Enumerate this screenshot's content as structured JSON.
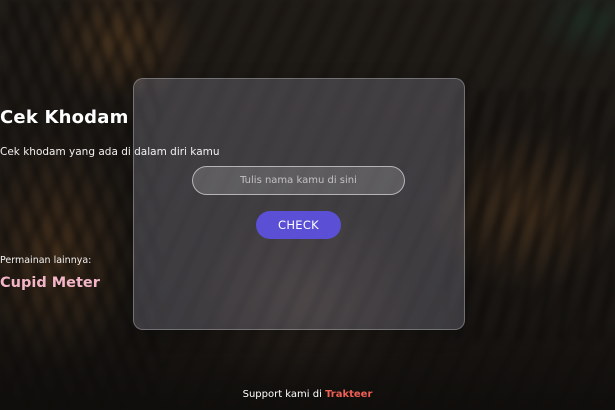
{
  "card": {
    "title": "Cek Khodam",
    "subtitle": "Cek khodam yang ada di dalam diri kamu",
    "name_input": {
      "value": "",
      "placeholder": "Tulis nama kamu di sini"
    },
    "check_button_label": "CHECK",
    "other_games_label": "Permainan lainnya:",
    "other_game_link": "Cupid Meter"
  },
  "footer": {
    "text": "Support kami di",
    "link_label": "Trakteer"
  },
  "colors": {
    "button": "#5b4fd6",
    "cupid_link": "#f2b6c8",
    "footer_link": "#ef5f55",
    "card_background": "rgba(170,170,195,0.26)"
  }
}
